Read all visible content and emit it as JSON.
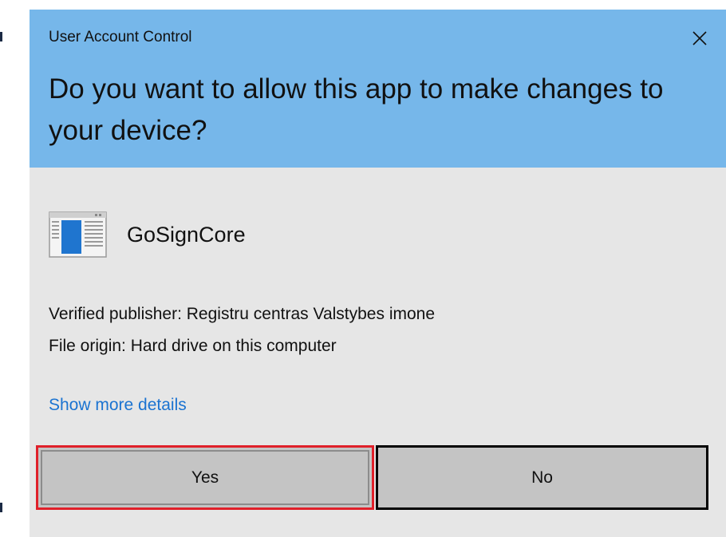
{
  "dialog": {
    "window_title": "User Account Control",
    "close_icon": "close-icon",
    "question": "Do you want to allow this app to make changes to your device?",
    "app": {
      "icon": "app-window-icon",
      "name": "GoSignCore"
    },
    "publisher_line": "Verified publisher: Registru centras Valstybes imone",
    "origin_line": "File origin: Hard drive on this computer",
    "details_link": "Show more details",
    "buttons": {
      "yes": "Yes",
      "no": "No"
    }
  },
  "colors": {
    "header_bg": "#76b7ea",
    "body_bg": "#e6e6e6",
    "button_bg": "#c4c4c4",
    "link": "#1a73d1",
    "highlight": "#e0202a"
  }
}
